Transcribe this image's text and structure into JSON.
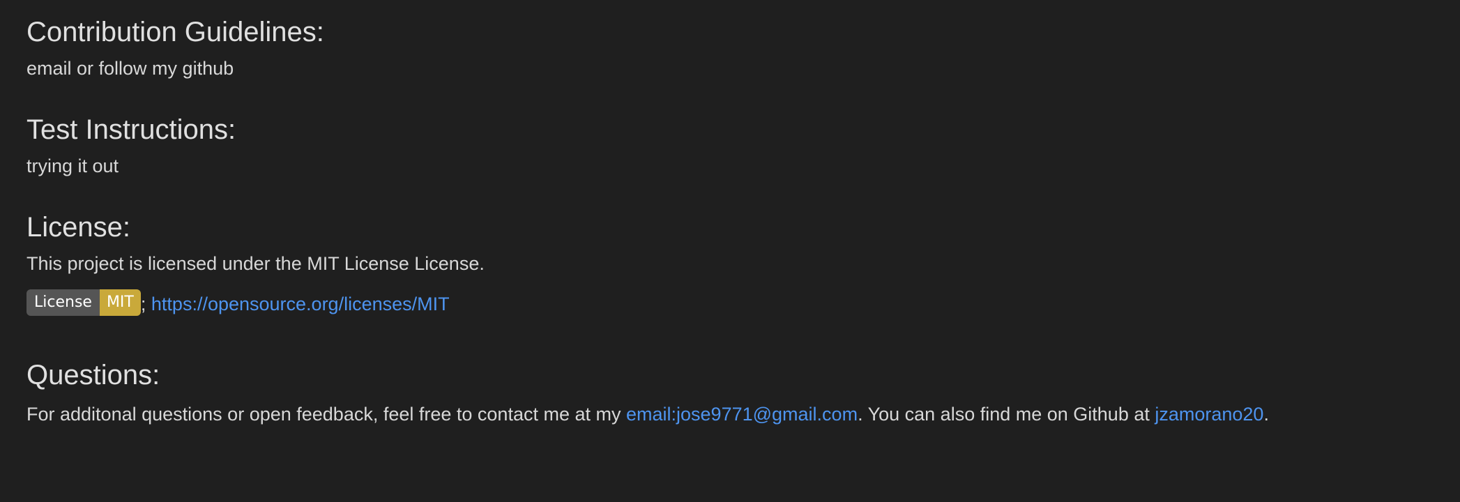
{
  "sections": {
    "contribution": {
      "heading": "Contribution Guidelines:",
      "body": "email or follow my github"
    },
    "tests": {
      "heading": "Test Instructions:",
      "body": "trying it out"
    },
    "license": {
      "heading": "License:",
      "body": "This project is licensed under the MIT License License.",
      "badge": {
        "label": "License",
        "message": "MIT",
        "label_color": "#555555",
        "message_color": "#c9a93a"
      },
      "separator": ";",
      "link_text": "https://opensource.org/licenses/MIT"
    },
    "questions": {
      "heading": "Questions:",
      "text_before": "For additonal questions or open feedback, feel free to contact me at my ",
      "email_link": "email:jose9771@gmail.com",
      "text_middle": ". You can also find me on Github at ",
      "github_link": "jzamorano20",
      "text_after": "."
    }
  },
  "colors": {
    "background": "#1f1f1f",
    "text": "#d8d8d8",
    "link": "#4e94ef"
  }
}
